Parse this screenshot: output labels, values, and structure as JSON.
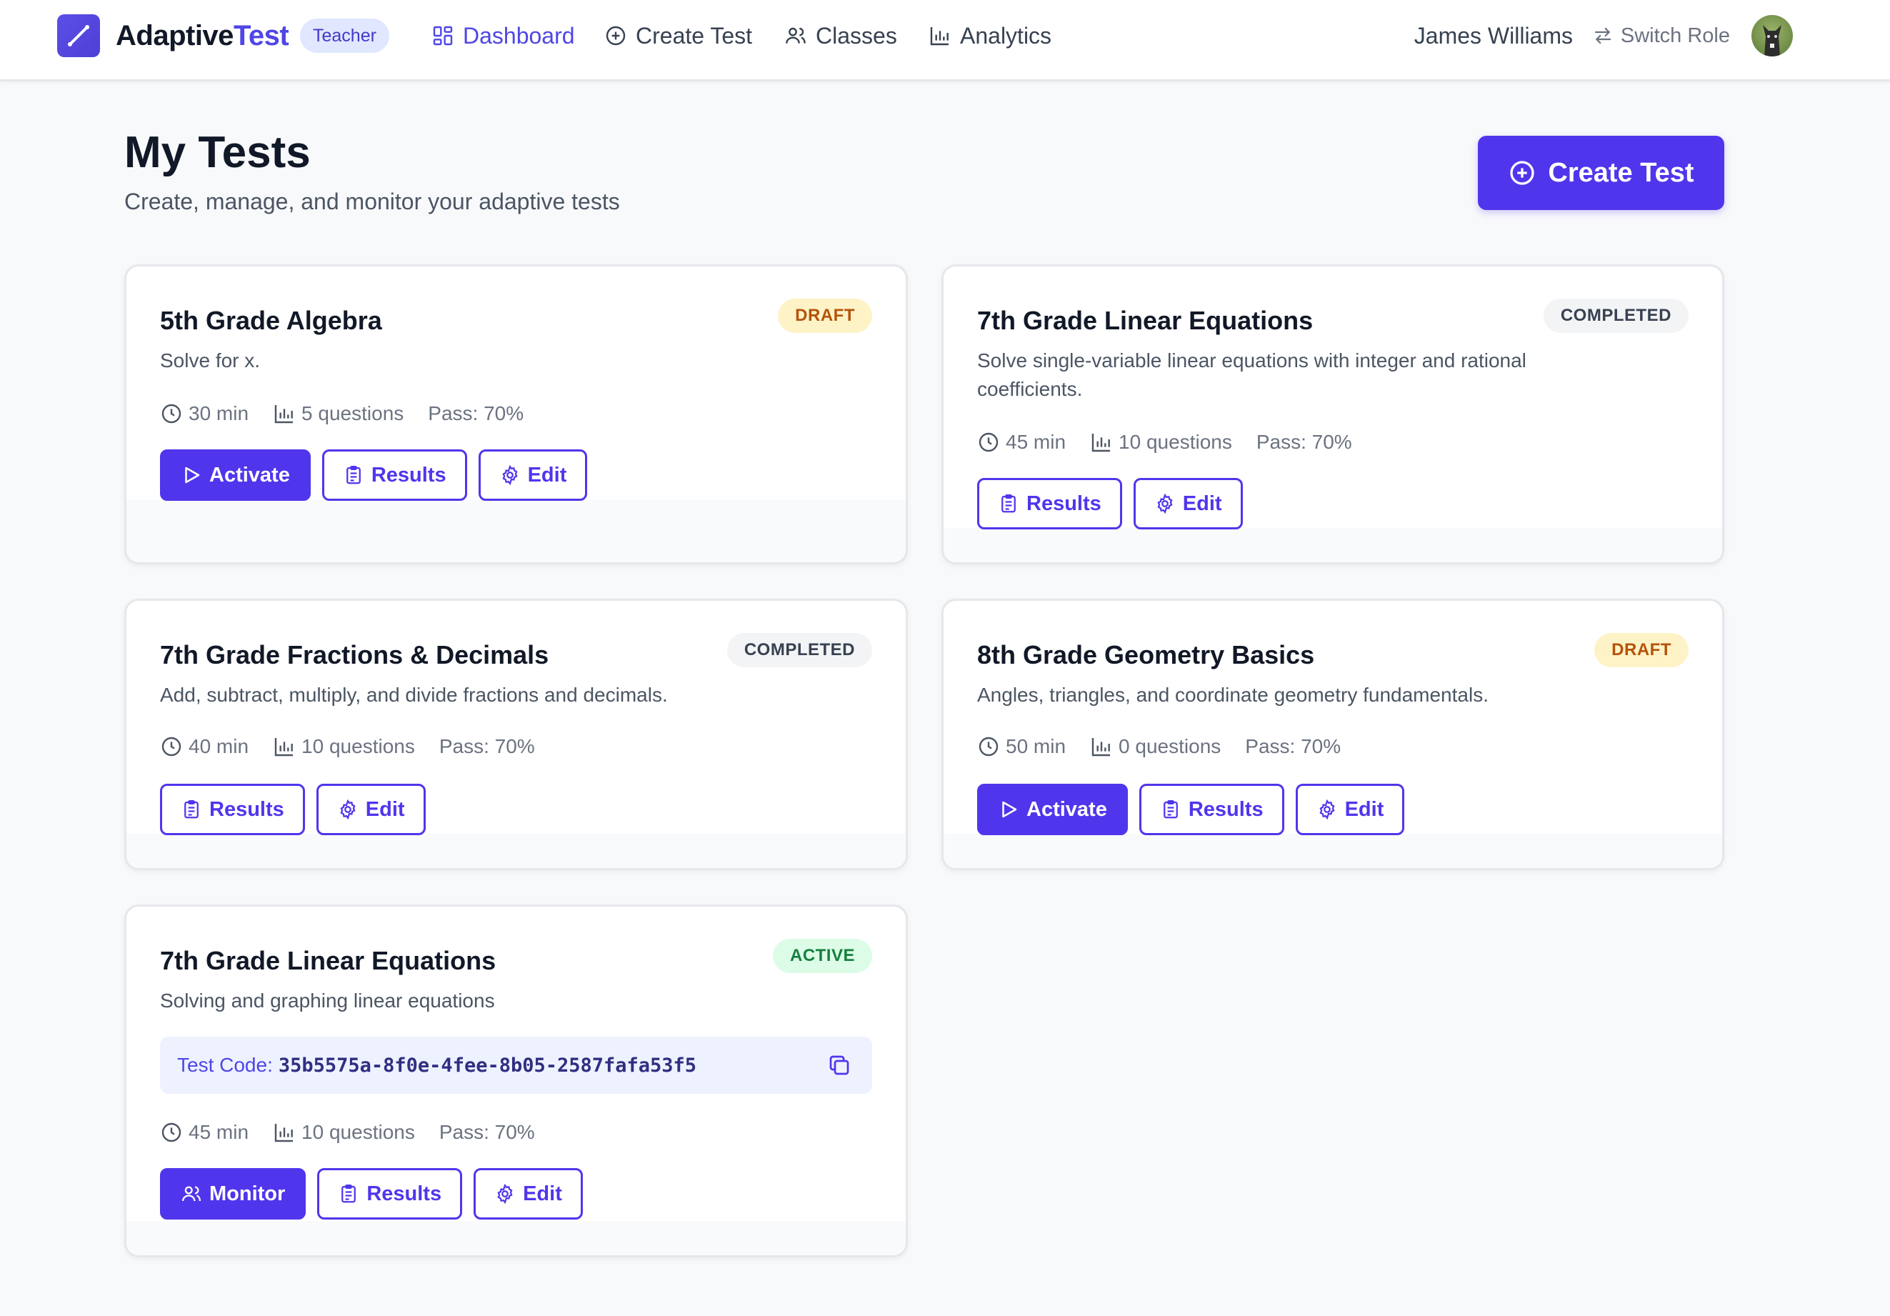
{
  "nav": {
    "brand_part1": "Adaptive",
    "brand_part2": "Test",
    "role_badge": "Teacher",
    "items": [
      {
        "label": "Dashboard",
        "icon": "grid-icon",
        "active": true
      },
      {
        "label": "Create Test",
        "icon": "plus-circle-icon",
        "active": false
      },
      {
        "label": "Classes",
        "icon": "users-icon",
        "active": false
      },
      {
        "label": "Analytics",
        "icon": "bar-chart-icon",
        "active": false
      }
    ],
    "user_name": "James Williams",
    "switch_role": "Switch Role"
  },
  "header": {
    "title": "My Tests",
    "subtitle": "Create, manage, and monitor your adaptive tests",
    "create_button": "Create Test"
  },
  "labels": {
    "activate": "Activate",
    "results": "Results",
    "edit": "Edit",
    "monitor": "Monitor",
    "test_code": "Test Code:"
  },
  "tests": [
    {
      "title": "5th Grade Algebra",
      "status": "DRAFT",
      "description": "Solve for x.",
      "duration": "30 min",
      "questions": "5 questions",
      "pass": "Pass: 70%"
    },
    {
      "title": "7th Grade Linear Equations",
      "status": "COMPLETED",
      "description_line1": "Solve single-variable linear equations with integer and rational",
      "description_line2": "coefficients.",
      "duration": "45 min",
      "questions": "10 questions",
      "pass": "Pass: 70%"
    },
    {
      "title": "7th Grade Fractions & Decimals",
      "status": "COMPLETED",
      "description": "Add, subtract, multiply, and divide fractions and decimals.",
      "duration": "40 min",
      "questions": "10 questions",
      "pass": "Pass: 70%"
    },
    {
      "title": "8th Grade Geometry Basics",
      "status": "DRAFT",
      "description": "Angles, triangles, and coordinate geometry fundamentals.",
      "duration": "50 min",
      "questions": "0 questions",
      "pass": "Pass: 70%"
    },
    {
      "title": "7th Grade Linear Equations",
      "status": "ACTIVE",
      "description": "Solving and graphing linear equations",
      "test_code": "35b5575a-8f0e-4fee-8b05-2587fafa53f5",
      "duration": "45 min",
      "questions": "10 questions",
      "pass": "Pass: 70%"
    }
  ],
  "colors": {
    "primary": "#4f36ec",
    "draft_bg": "#fef3c7",
    "draft_text": "#b45309",
    "completed_bg": "#f3f4f6",
    "active_bg": "#dcfce7",
    "active_text": "#15803d"
  }
}
